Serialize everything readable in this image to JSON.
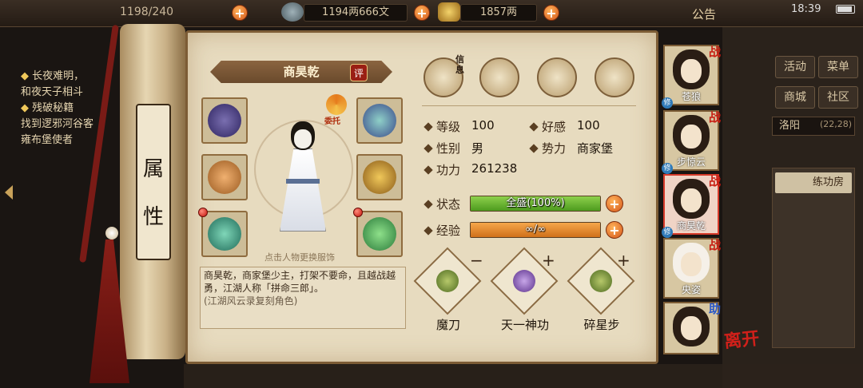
{
  "topbar": {
    "capacity_text": "1198/240",
    "currency_silver": "1194两666文",
    "currency_gold": "1857两",
    "notice": "公告",
    "time": "18:39"
  },
  "quest": {
    "line1": "长夜难明，",
    "line2": "和夜天子相斗",
    "line3": "残破秘籍",
    "line4": "找到逻邪河谷客",
    "line5": "雍布堡使者"
  },
  "scroll_title": "属性",
  "character": {
    "name": "商昊乾",
    "eval_label": "评",
    "swap_label": "委托",
    "hint": "点击人物更换服饰",
    "description": "商昊乾，商家堡少主，打架不要命，且越战越勇，江湖人称「拼命三郎」。",
    "description_note": "(江湖风云录复刻角色)"
  },
  "icons": {
    "info_label": "信息"
  },
  "stats": {
    "level_label": "等级",
    "level_value": "100",
    "affinity_label": "好感",
    "affinity_value": "100",
    "gender_label": "性别",
    "gender_value": "男",
    "faction_label": "势力",
    "faction_value": "商家堡",
    "power_label": "功力",
    "power_value": "261238",
    "status_label": "状态",
    "status_text": "全盛(100%)",
    "status_percent": 100,
    "exp_label": "经验",
    "exp_text": "∞/∞"
  },
  "skills": [
    {
      "name": "魔刀"
    },
    {
      "name": "天一神功"
    },
    {
      "name": "碎星步"
    }
  ],
  "skill_signs": {
    "minus": "−",
    "plus": "+"
  },
  "party": [
    {
      "name": "苍狼",
      "tag": "战"
    },
    {
      "name": "步惊云",
      "tag": "战"
    },
    {
      "name": "商昊乾",
      "tag": "战"
    },
    {
      "name": "央姿",
      "tag": "战"
    },
    {
      "name": "",
      "tag": "助"
    }
  ],
  "party_mark": "修",
  "leave_label": "离开",
  "side_menu": {
    "activity": "活动",
    "menu": "菜单",
    "shop": "商城",
    "community": "社区",
    "location": "洛阳",
    "coords": "(22,28)",
    "practice": "练功房"
  },
  "colors": {
    "status_bar": "#5fae2c",
    "exp_bar": "#e38a1e",
    "accent_red": "#c81d12"
  }
}
